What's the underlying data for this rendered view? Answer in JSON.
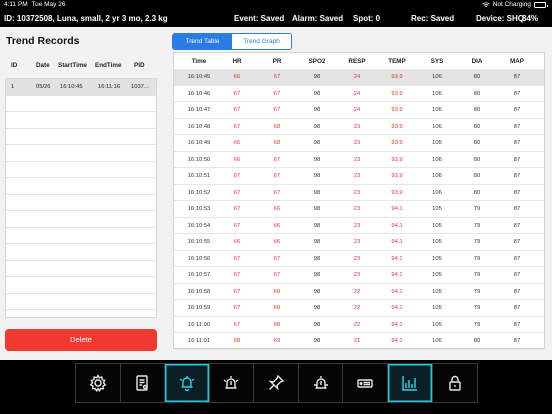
{
  "status": {
    "time": "4:11 PM",
    "date": "Tue May 26",
    "charging": "Not Charging"
  },
  "info": {
    "patient": "ID: 10372508, Luna, small, 2 yr 3 mo, 2.3 kg",
    "event": "Event: Saved",
    "alarm": "Alarm: Saved",
    "spot": "Spot: 0",
    "rec": "Rec: Saved",
    "device": "Device: SHQ",
    "battery": "84%"
  },
  "left": {
    "title": "Trend Records",
    "headers": {
      "id": "ID",
      "date": "Date",
      "start": "StartTime",
      "end": "EndTime",
      "pid": "PID"
    },
    "records": [
      {
        "id": "1",
        "date": "05/26",
        "start": "16:10:45",
        "end": "16:11:16",
        "pid": "1037..."
      }
    ],
    "delete_label": "Delete"
  },
  "tabs": {
    "table": "Trend Table",
    "graph": "Trend Graph"
  },
  "table": {
    "headers": [
      "Time",
      "HR",
      "PR",
      "SPO2",
      "RESP",
      "TEMP",
      "SYS",
      "DIA",
      "MAP"
    ],
    "rows": [
      [
        "16:10:45",
        "66",
        "67",
        "98",
        "24",
        "93.9",
        "106",
        "80",
        "87"
      ],
      [
        "16:10:46",
        "67",
        "67",
        "98",
        "24",
        "93.9",
        "106",
        "80",
        "87"
      ],
      [
        "16:10:47",
        "67",
        "67",
        "98",
        "24",
        "93.9",
        "106",
        "80",
        "87"
      ],
      [
        "16:10:48",
        "67",
        "68",
        "98",
        "23",
        "93.9",
        "106",
        "80",
        "87"
      ],
      [
        "16:10:49",
        "66",
        "68",
        "98",
        "23",
        "93.9",
        "105",
        "80",
        "87"
      ],
      [
        "16:10:50",
        "66",
        "67",
        "98",
        "23",
        "93.9",
        "106",
        "80",
        "87"
      ],
      [
        "16:10:51",
        "67",
        "67",
        "98",
        "23",
        "93.9",
        "106",
        "80",
        "87"
      ],
      [
        "16:10:52",
        "67",
        "67",
        "98",
        "23",
        "93.9",
        "106",
        "80",
        "87"
      ],
      [
        "16:10:53",
        "67",
        "66",
        "98",
        "23",
        "94.1",
        "105",
        "79",
        "87"
      ],
      [
        "16:10:54",
        "67",
        "66",
        "98",
        "23",
        "94.1",
        "105",
        "79",
        "87"
      ],
      [
        "16:10:55",
        "66",
        "66",
        "98",
        "23",
        "94.1",
        "105",
        "79",
        "87"
      ],
      [
        "16:10:56",
        "67",
        "67",
        "98",
        "23",
        "94.1",
        "105",
        "79",
        "87"
      ],
      [
        "16:10:57",
        "67",
        "67",
        "98",
        "23",
        "94.1",
        "105",
        "79",
        "87"
      ],
      [
        "16:10:58",
        "67",
        "68",
        "98",
        "22",
        "94.1",
        "105",
        "79",
        "87"
      ],
      [
        "16:10:59",
        "67",
        "68",
        "98",
        "22",
        "94.1",
        "105",
        "79",
        "87"
      ],
      [
        "16:11:00",
        "67",
        "68",
        "98",
        "22",
        "94.1",
        "105",
        "79",
        "87"
      ],
      [
        "16:11:01",
        "68",
        "69",
        "98",
        "21",
        "94.1",
        "106",
        "80",
        "87"
      ]
    ]
  },
  "dock": {
    "icons": [
      "gear-icon",
      "report-icon",
      "alarm-bell-icon",
      "alarm-alert-icon",
      "pin-icon",
      "event-alert-icon",
      "record-icon",
      "trend-chart-icon",
      "lock-icon"
    ],
    "active": [
      "alarm-bell-icon",
      "trend-chart-icon"
    ]
  },
  "colors": {
    "accent": "#2a7be4",
    "alert": "#e4362e",
    "delete": "#f03a30",
    "active_dock": "#2ad4f0"
  }
}
